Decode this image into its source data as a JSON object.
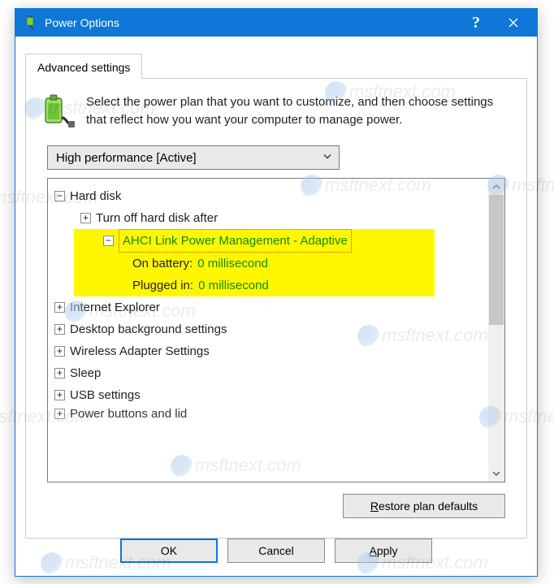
{
  "titlebar": {
    "title": "Power Options"
  },
  "tab": {
    "label": "Advanced settings"
  },
  "intro": {
    "text": "Select the power plan that you want to customize, and then choose settings that reflect how you want your computer to manage power."
  },
  "plan_select": {
    "value": "High performance [Active]"
  },
  "tree": {
    "hard_disk": {
      "label": "Hard disk",
      "turn_off": "Turn off hard disk after",
      "ahci": {
        "label": "AHCI Link Power Management - Adaptive",
        "on_battery_label": "On battery:",
        "on_battery_value": "0 millisecond",
        "plugged_in_label": "Plugged in:",
        "plugged_in_value": "0 millisecond"
      }
    },
    "ie": "Internet Explorer",
    "desktop": "Desktop background settings",
    "wireless": "Wireless Adapter Settings",
    "sleep": "Sleep",
    "usb": "USB settings",
    "power_buttons": "Power buttons and lid"
  },
  "restore": {
    "prefix": "R",
    "rest": "estore plan defaults"
  },
  "buttons": {
    "ok": "OK",
    "cancel": "Cancel",
    "apply_prefix": "A",
    "apply_rest": "pply"
  },
  "watermark": "msftnext.com"
}
